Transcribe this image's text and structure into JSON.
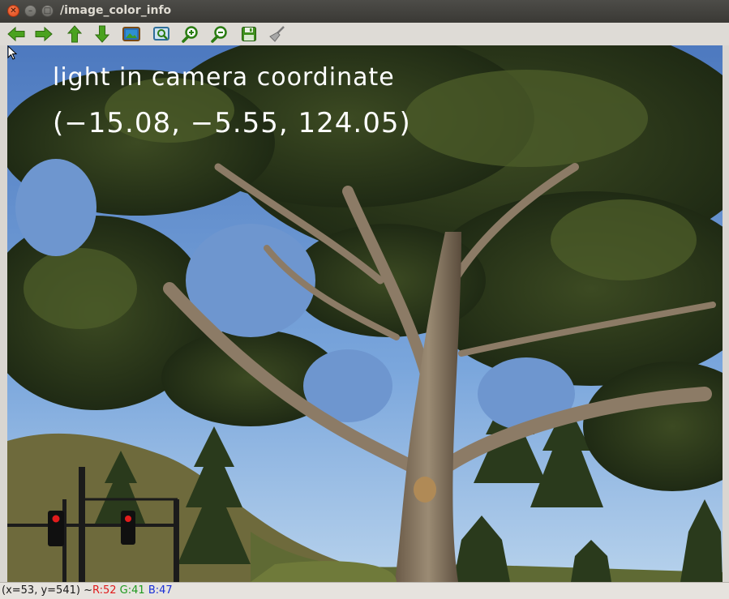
{
  "window": {
    "title": "/image_color_info",
    "controls": {
      "close_glyph": "✕",
      "minimize_glyph": "–",
      "maximize_glyph": "□"
    }
  },
  "toolbar": {
    "buttons": [
      {
        "name": "back",
        "icon": "arrow-left-icon",
        "color": "#3f9a1c"
      },
      {
        "name": "forward",
        "icon": "arrow-right-icon",
        "color": "#3f9a1c"
      },
      {
        "name": "up",
        "icon": "arrow-up-icon",
        "color": "#3f9a1c"
      },
      {
        "name": "down",
        "icon": "arrow-down-icon",
        "color": "#3f9a1c"
      },
      {
        "name": "image",
        "icon": "image-icon"
      },
      {
        "name": "zoom-fit",
        "icon": "zoom-fit-icon"
      },
      {
        "name": "zoom-in",
        "icon": "zoom-in-icon"
      },
      {
        "name": "zoom-out",
        "icon": "zoom-out-icon"
      },
      {
        "name": "save",
        "icon": "save-icon"
      },
      {
        "name": "clear",
        "icon": "broom-icon"
      }
    ]
  },
  "image": {
    "overlay_line1": "light in camera coordinate",
    "overlay_line2": "(−15.08, −5.55, 124.05)"
  },
  "status": {
    "position": "(x=53, y=541) ~ ",
    "r": "R:52",
    "g": "G:41",
    "b": "B:47",
    "colors": {
      "r": "#e01b1b",
      "g": "#1f9a1f",
      "b": "#1a2fd6"
    }
  }
}
